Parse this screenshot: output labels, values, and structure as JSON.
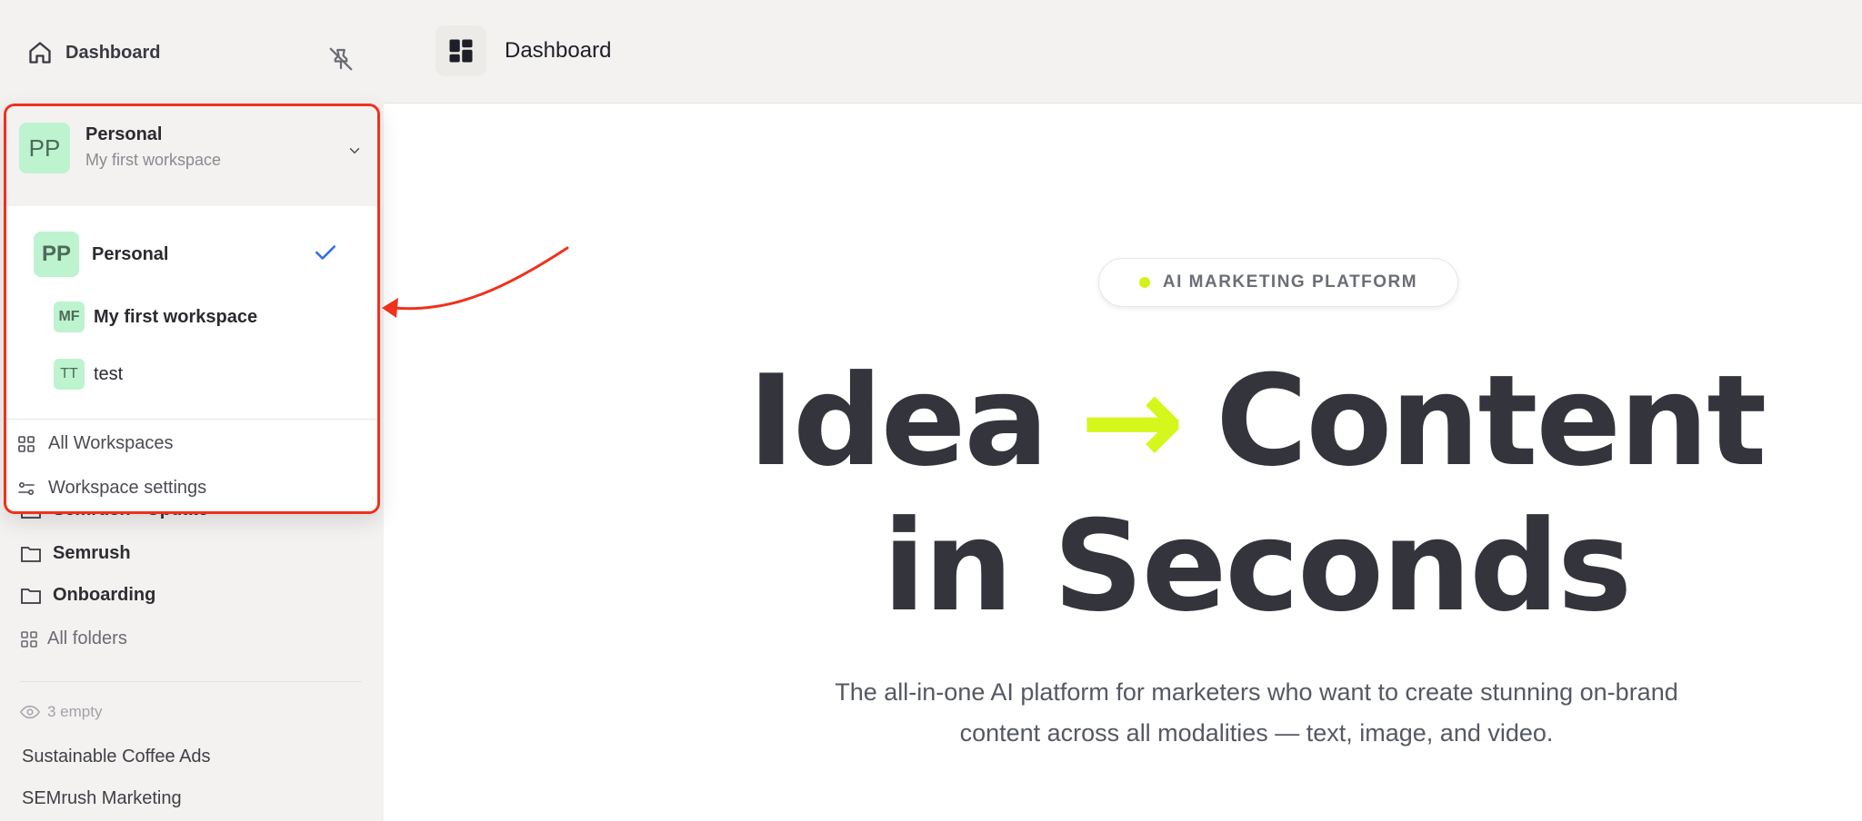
{
  "sidebar": {
    "dashboard_label": "Dashboard",
    "partial_label": "Semrush - Update",
    "folders": [
      {
        "label": "Semrush"
      },
      {
        "label": "Onboarding"
      }
    ],
    "all_folders_label": "All folders",
    "empty_label": "3 empty",
    "links": [
      {
        "label": "Sustainable Coffee Ads"
      },
      {
        "label": "SEMrush Marketing"
      }
    ]
  },
  "topbar": {
    "title": "Dashboard"
  },
  "workspace_dropdown": {
    "current": {
      "initials": "PP",
      "name": "Personal",
      "workspace": "My first workspace"
    },
    "personal": {
      "initials": "PP",
      "name": "Personal"
    },
    "workspaces": [
      {
        "initials": "MF",
        "name": "My first workspace"
      },
      {
        "initials": "TT",
        "name": "test"
      }
    ],
    "all_workspaces_label": "All Workspaces",
    "settings_label": "Workspace settings"
  },
  "hero": {
    "badge": "AI MARKETING PLATFORM",
    "line1_left": "Idea",
    "arrow": "→",
    "line1_right": "Content",
    "line2": "in Seconds",
    "subtitle_line1": "The all-in-one AI platform for marketers who want to create stunning on-brand",
    "subtitle_line2": "content across all modalities — text, image, and video."
  },
  "colors": {
    "accent_lime": "#d4f21a",
    "annotation_red": "#f0311b",
    "avatar_green": "#bdf3cf",
    "check_blue": "#2f6fe8"
  }
}
